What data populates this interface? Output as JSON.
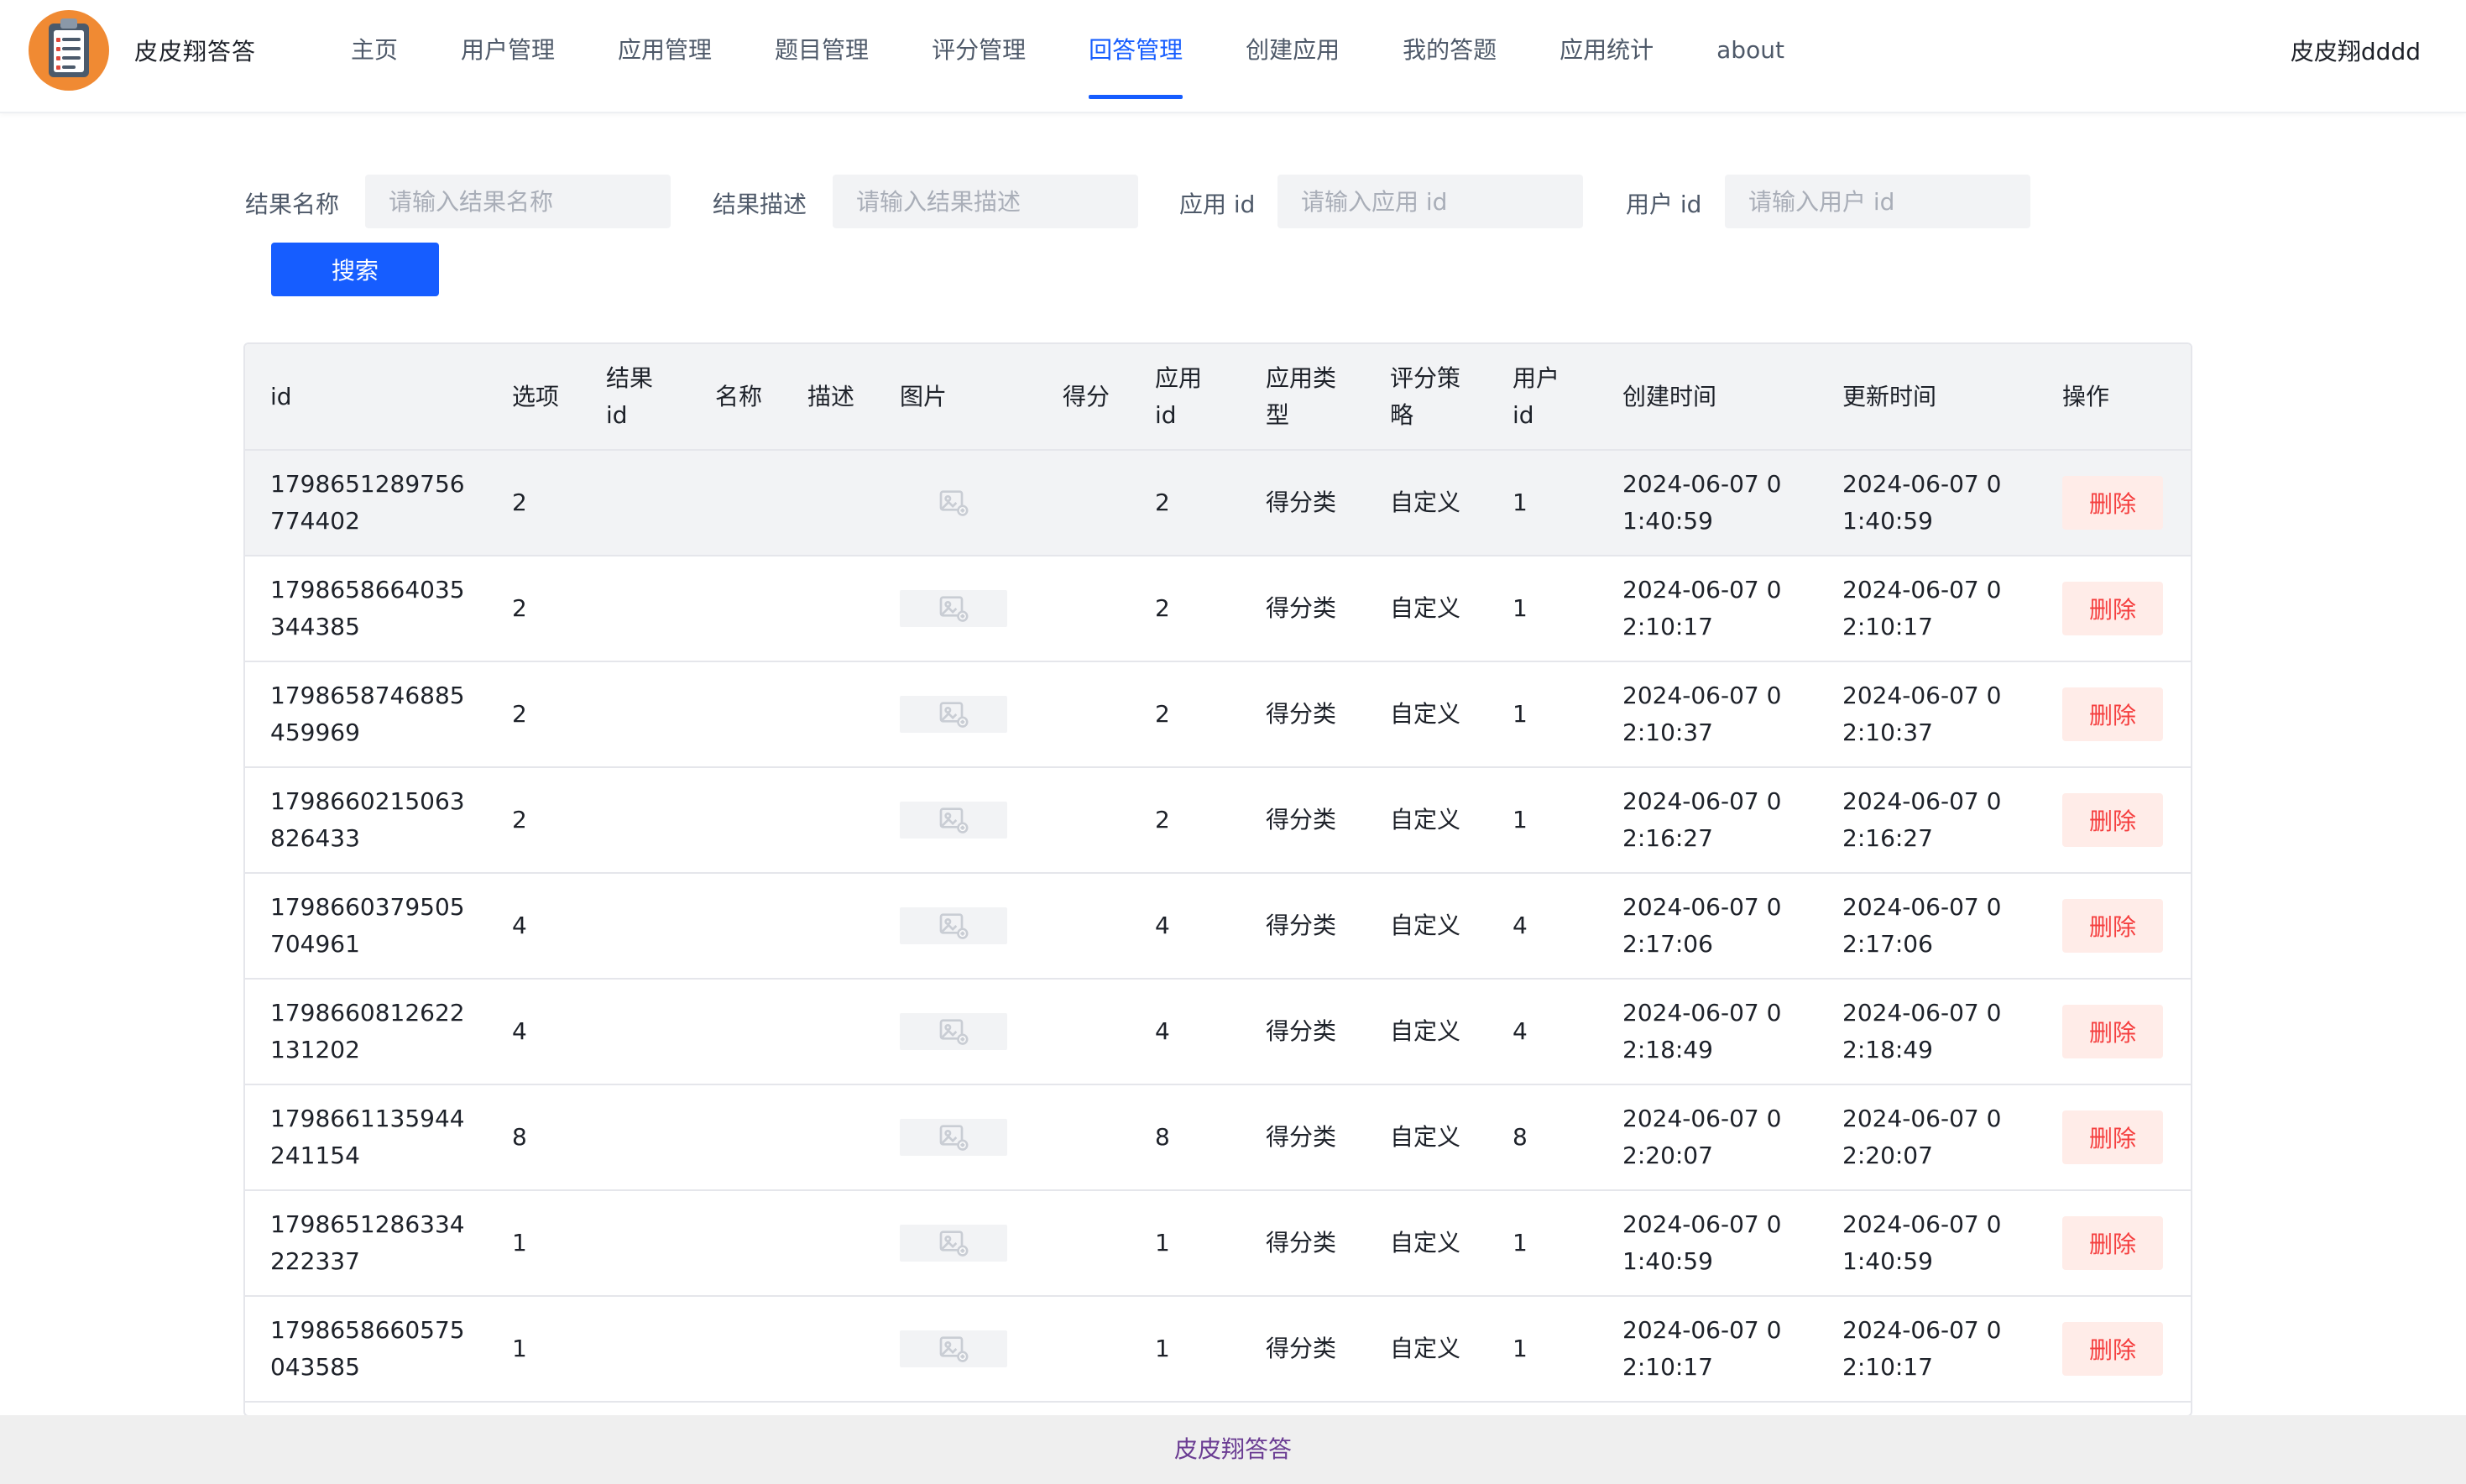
{
  "brand": {
    "title": "皮皮翔答答"
  },
  "nav": {
    "items": [
      {
        "label": "主页",
        "active": false
      },
      {
        "label": "用户管理",
        "active": false
      },
      {
        "label": "应用管理",
        "active": false
      },
      {
        "label": "题目管理",
        "active": false
      },
      {
        "label": "评分管理",
        "active": false
      },
      {
        "label": "回答管理",
        "active": true
      },
      {
        "label": "创建应用",
        "active": false
      },
      {
        "label": "我的答题",
        "active": false
      },
      {
        "label": "应用统计",
        "active": false
      },
      {
        "label": "about",
        "active": false
      }
    ]
  },
  "user": {
    "name": "皮皮翔dddd"
  },
  "search": {
    "fields": [
      {
        "label": "结果名称",
        "placeholder": "请输入结果名称",
        "value": ""
      },
      {
        "label": "结果描述",
        "placeholder": "请输入结果描述",
        "value": ""
      },
      {
        "label": "应用 id",
        "placeholder": "请输入应用 id",
        "value": ""
      },
      {
        "label": "用户 id",
        "placeholder": "请输入用户 id",
        "value": ""
      }
    ],
    "button_label": "搜索"
  },
  "table": {
    "columns": [
      "id",
      "选项",
      "结果 id",
      "名称",
      "描述",
      "图片",
      "得分",
      "应用 id",
      "应用类型",
      "评分策略",
      "用户 id",
      "创建时间",
      "更新时间",
      "操作"
    ],
    "delete_label": "删除",
    "rows": [
      {
        "id": "1798651289756774402",
        "choice": "2",
        "result_id": "",
        "name": "",
        "desc": "",
        "score": "",
        "app_id": "2",
        "app_type": "得分类",
        "strategy": "自定义",
        "user_id": "1",
        "created": "2024-06-07 01:40:59",
        "updated": "2024-06-07 01:40:59"
      },
      {
        "id": "1798658664035344385",
        "choice": "2",
        "result_id": "",
        "name": "",
        "desc": "",
        "score": "",
        "app_id": "2",
        "app_type": "得分类",
        "strategy": "自定义",
        "user_id": "1",
        "created": "2024-06-07 02:10:17",
        "updated": "2024-06-07 02:10:17"
      },
      {
        "id": "1798658746885459969",
        "choice": "2",
        "result_id": "",
        "name": "",
        "desc": "",
        "score": "",
        "app_id": "2",
        "app_type": "得分类",
        "strategy": "自定义",
        "user_id": "1",
        "created": "2024-06-07 02:10:37",
        "updated": "2024-06-07 02:10:37"
      },
      {
        "id": "1798660215063826433",
        "choice": "2",
        "result_id": "",
        "name": "",
        "desc": "",
        "score": "",
        "app_id": "2",
        "app_type": "得分类",
        "strategy": "自定义",
        "user_id": "1",
        "created": "2024-06-07 02:16:27",
        "updated": "2024-06-07 02:16:27"
      },
      {
        "id": "1798660379505704961",
        "choice": "4",
        "result_id": "",
        "name": "",
        "desc": "",
        "score": "",
        "app_id": "4",
        "app_type": "得分类",
        "strategy": "自定义",
        "user_id": "4",
        "created": "2024-06-07 02:17:06",
        "updated": "2024-06-07 02:17:06"
      },
      {
        "id": "1798660812622131202",
        "choice": "4",
        "result_id": "",
        "name": "",
        "desc": "",
        "score": "",
        "app_id": "4",
        "app_type": "得分类",
        "strategy": "自定义",
        "user_id": "4",
        "created": "2024-06-07 02:18:49",
        "updated": "2024-06-07 02:18:49"
      },
      {
        "id": "1798661135944241154",
        "choice": "8",
        "result_id": "",
        "name": "",
        "desc": "",
        "score": "",
        "app_id": "8",
        "app_type": "得分类",
        "strategy": "自定义",
        "user_id": "8",
        "created": "2024-06-07 02:20:07",
        "updated": "2024-06-07 02:20:07"
      },
      {
        "id": "1798651286334222337",
        "choice": "1",
        "result_id": "",
        "name": "",
        "desc": "",
        "score": "",
        "app_id": "1",
        "app_type": "得分类",
        "strategy": "自定义",
        "user_id": "1",
        "created": "2024-06-07 01:40:59",
        "updated": "2024-06-07 01:40:59"
      },
      {
        "id": "1798658660575043585",
        "choice": "1",
        "result_id": "",
        "name": "",
        "desc": "",
        "score": "",
        "app_id": "1",
        "app_type": "得分类",
        "strategy": "自定义",
        "user_id": "1",
        "created": "2024-06-07 02:10:17",
        "updated": "2024-06-07 02:10:17"
      }
    ]
  },
  "footer": {
    "text": "皮皮翔答答"
  },
  "colors": {
    "accent": "#165dff",
    "danger": "#f53f3f",
    "danger_bg": "#ffece8",
    "footer_text": "#6b3d93"
  }
}
